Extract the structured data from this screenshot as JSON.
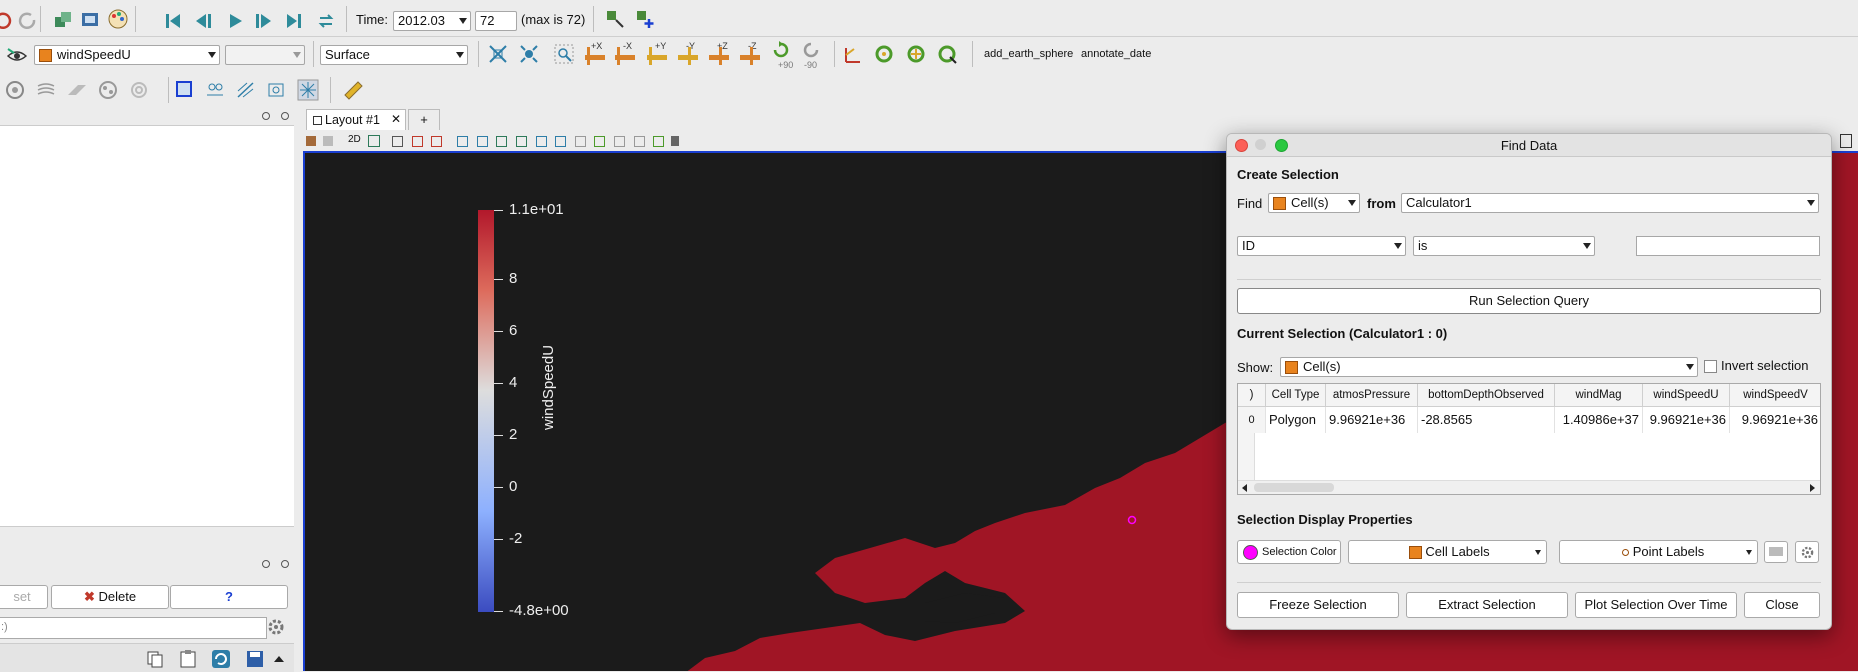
{
  "toolbar1": {
    "time_label": "Time:",
    "time_value": "2012.03",
    "step_value": "72",
    "max_label": "(max is 72)"
  },
  "toolbar2": {
    "array_value": "windSpeedU",
    "component_value": "",
    "representation_value": "Surface",
    "macro_1": "add_earth_sphere",
    "macro_2": "annotate_date",
    "rot_plus90": "+90",
    "rot_minus90": "-90",
    "axis_labels": [
      "+X",
      "-X",
      "+Y",
      "-Y",
      "+Z",
      "-Z"
    ]
  },
  "left_panel": {
    "reset_label": "set",
    "delete_label": "Delete",
    "help_label": "?",
    "search_text": ":)"
  },
  "layout": {
    "tab_label": "Layout #1",
    "add_tab_label": "+",
    "view_2d_label": "2D"
  },
  "colorbar": {
    "title": "windSpeedU",
    "ticks": [
      "1.1e+01",
      "8",
      "6",
      "4",
      "2",
      "0",
      "-2",
      "-4.8e+00"
    ],
    "colors": {
      "max": "#b2182b",
      "mid": "#dddddd",
      "min": "#3b4cc0"
    }
  },
  "find_data": {
    "title": "Find Data",
    "create_selection_header": "Create Selection",
    "find_label": "Find",
    "find_type": "Cell(s)",
    "from_label": "from",
    "from_source": "Calculator1",
    "criteria_field": "ID",
    "criteria_operator": "is",
    "criteria_value": "",
    "run_query_label": "Run Selection Query",
    "current_selection_header": "Current Selection (Calculator1 : 0)",
    "show_label": "Show:",
    "show_type": "Cell(s)",
    "invert_label": "Invert selection",
    "invert_checked": false,
    "table": {
      "columns": [
        ")",
        "Cell Type",
        "atmosPressure",
        "bottomDepthObserved",
        "windMag",
        "windSpeedU",
        "windSpeedV"
      ],
      "rows": [
        [
          "0",
          "Polygon",
          "9.96921e+36",
          "-28.8565",
          "1.40986e+37",
          "9.96921e+36",
          "9.96921e+36"
        ]
      ]
    },
    "display_props_header": "Selection Display Properties",
    "selection_color_label": "Selection Color",
    "selection_color": "#ff00ff",
    "cell_labels_label": "Cell Labels",
    "point_labels_label": "Point Labels",
    "freeze_label": "Freeze Selection",
    "extract_label": "Extract Selection",
    "plot_label": "Plot Selection Over Time",
    "close_label": "Close"
  },
  "colors": {
    "accent": "#1a3fd1",
    "viewport_bg": "#1b1b1b",
    "land": "#a01525"
  }
}
